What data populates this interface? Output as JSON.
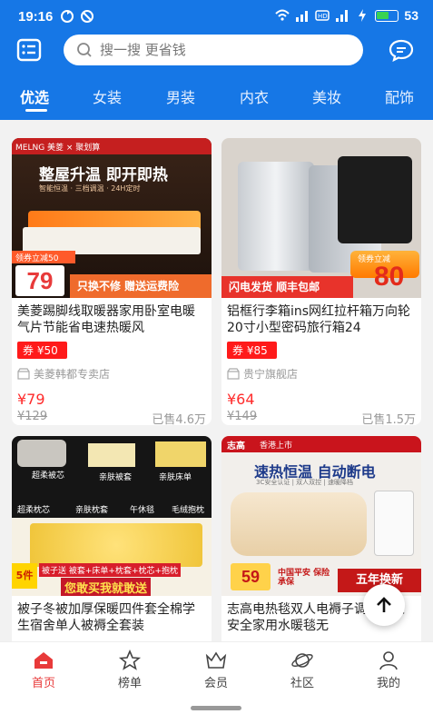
{
  "status": {
    "time": "19:16",
    "battery": "53"
  },
  "search": {
    "placeholder": "搜一搜 更省钱"
  },
  "tabs": [
    "优选",
    "女装",
    "男装",
    "内衣",
    "美妆",
    "配饰"
  ],
  "products": [
    {
      "title": "美菱踢脚线取暖器家用卧室电暖气片节能省电速热暖风",
      "coupon": "券 ¥50",
      "shop": "美菱韩都专卖店",
      "price": "¥79",
      "old_price": "¥129",
      "sold": "已售4.6万",
      "img": {
        "brand": "MELNG 美菱 × 聚划算",
        "headline": "整屋升温 即开即热",
        "features": "智能恒温 · 三档调温 · 24H定时",
        "coupon_label": "领券立减50",
        "price_tag": "79",
        "banner": "只换不修 赠送运费险"
      }
    },
    {
      "title": "铝框行李箱ins网红拉杆箱万向轮20寸小型密码旅行箱24",
      "coupon": "券 ¥85",
      "shop": "贵宁旗舰店",
      "price": "¥64",
      "old_price": "¥149",
      "sold": "已售1.5万",
      "img": {
        "coupon_label": "领券立减",
        "price_tag": "80",
        "banner": "闪电发货 顺丰包邮"
      }
    },
    {
      "title": "被子冬被加厚保暖四件套全棉学生宿舍单人被褥全套装",
      "img": {
        "labels": [
          "超柔被芯",
          "亲肤被套",
          "亲肤床单",
          "超柔枕芯",
          "亲肤枕套",
          "午休毯",
          "毛绒抱枕"
        ],
        "badge": "5件",
        "banner": "被子送 被套+床单+枕套+枕芯+抱枕",
        "slogan": "您敢买我就敢送"
      }
    },
    {
      "title": "志高电热毯双人电褥子调温单人安全家用水暖毯无",
      "img": {
        "brand": "志高",
        "brand_tag": "香港上市",
        "headline": "速热恒温 自动断电",
        "sub": "3C安全认证 | 双人双控 | 速暖降档",
        "price_tag": "59",
        "banner_left": "中国平安 保险承保",
        "banner_right": "五年换新"
      }
    }
  ],
  "nav": [
    "首页",
    "榜单",
    "会员",
    "社区",
    "我的"
  ],
  "colors": {
    "primary": "#1677e6",
    "price": "#ff2b2b",
    "active_nav": "#e83a3a"
  }
}
